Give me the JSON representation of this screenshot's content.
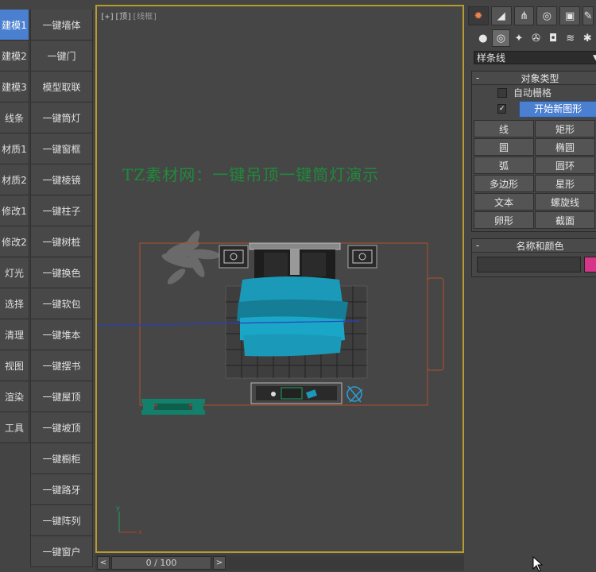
{
  "left_toolbar": {
    "col1": [
      "建模1",
      "建模2",
      "建模3",
      "线条",
      "材质1",
      "材质2",
      "修改1",
      "修改2",
      "灯光",
      "选择",
      "清理",
      "视图",
      "渲染",
      "工具"
    ],
    "col2": [
      "一键墙体",
      "一键门",
      "模型取联",
      "一键筒灯",
      "一键窗框",
      "一键棱镜",
      "一键柱子",
      "一键树桩",
      "一键换色",
      "一键软包",
      "一键堆本",
      "一键摆书",
      "一键屋顶",
      "一键坡顶",
      "一键橱柜",
      "一键路牙",
      "一键阵列",
      "一键窗户"
    ],
    "active": "建模1"
  },
  "viewport": {
    "label_plus": "[+]",
    "label_view": "[顶]",
    "label_mode": "[线框]",
    "demo_text": "TZ素材网：一键吊顶一键筒灯演示",
    "border_color": "#b79b2e"
  },
  "timeline": {
    "prev": "<",
    "frame": "0 / 100",
    "next": ">"
  },
  "command_panel": {
    "tabs": [
      "create-tab",
      "modify-tab",
      "hierarchy-tab",
      "motion-tab",
      "display-tab",
      "utilities-tab"
    ],
    "sub_icons": [
      "geometry",
      "shapes",
      "lights",
      "cameras",
      "helpers",
      "spacewarps",
      "systems"
    ],
    "dropdown_value": "样条线",
    "object_type": {
      "title": "对象类型",
      "autogrid_label": "自动栅格",
      "start_new_shape_label": "开始新图形",
      "buttons": [
        "线",
        "矩形",
        "圆",
        "椭圆",
        "弧",
        "圆环",
        "多边形",
        "星形",
        "文本",
        "螺旋线",
        "卵形",
        "截面"
      ]
    },
    "name_color": {
      "title": "名称和颜色",
      "name_value": "",
      "color": "#d8358a"
    }
  },
  "colors": {
    "accent": "#4b7fd0",
    "demo_text": "#1f8a3a",
    "viewport_border": "#b79b2e"
  }
}
